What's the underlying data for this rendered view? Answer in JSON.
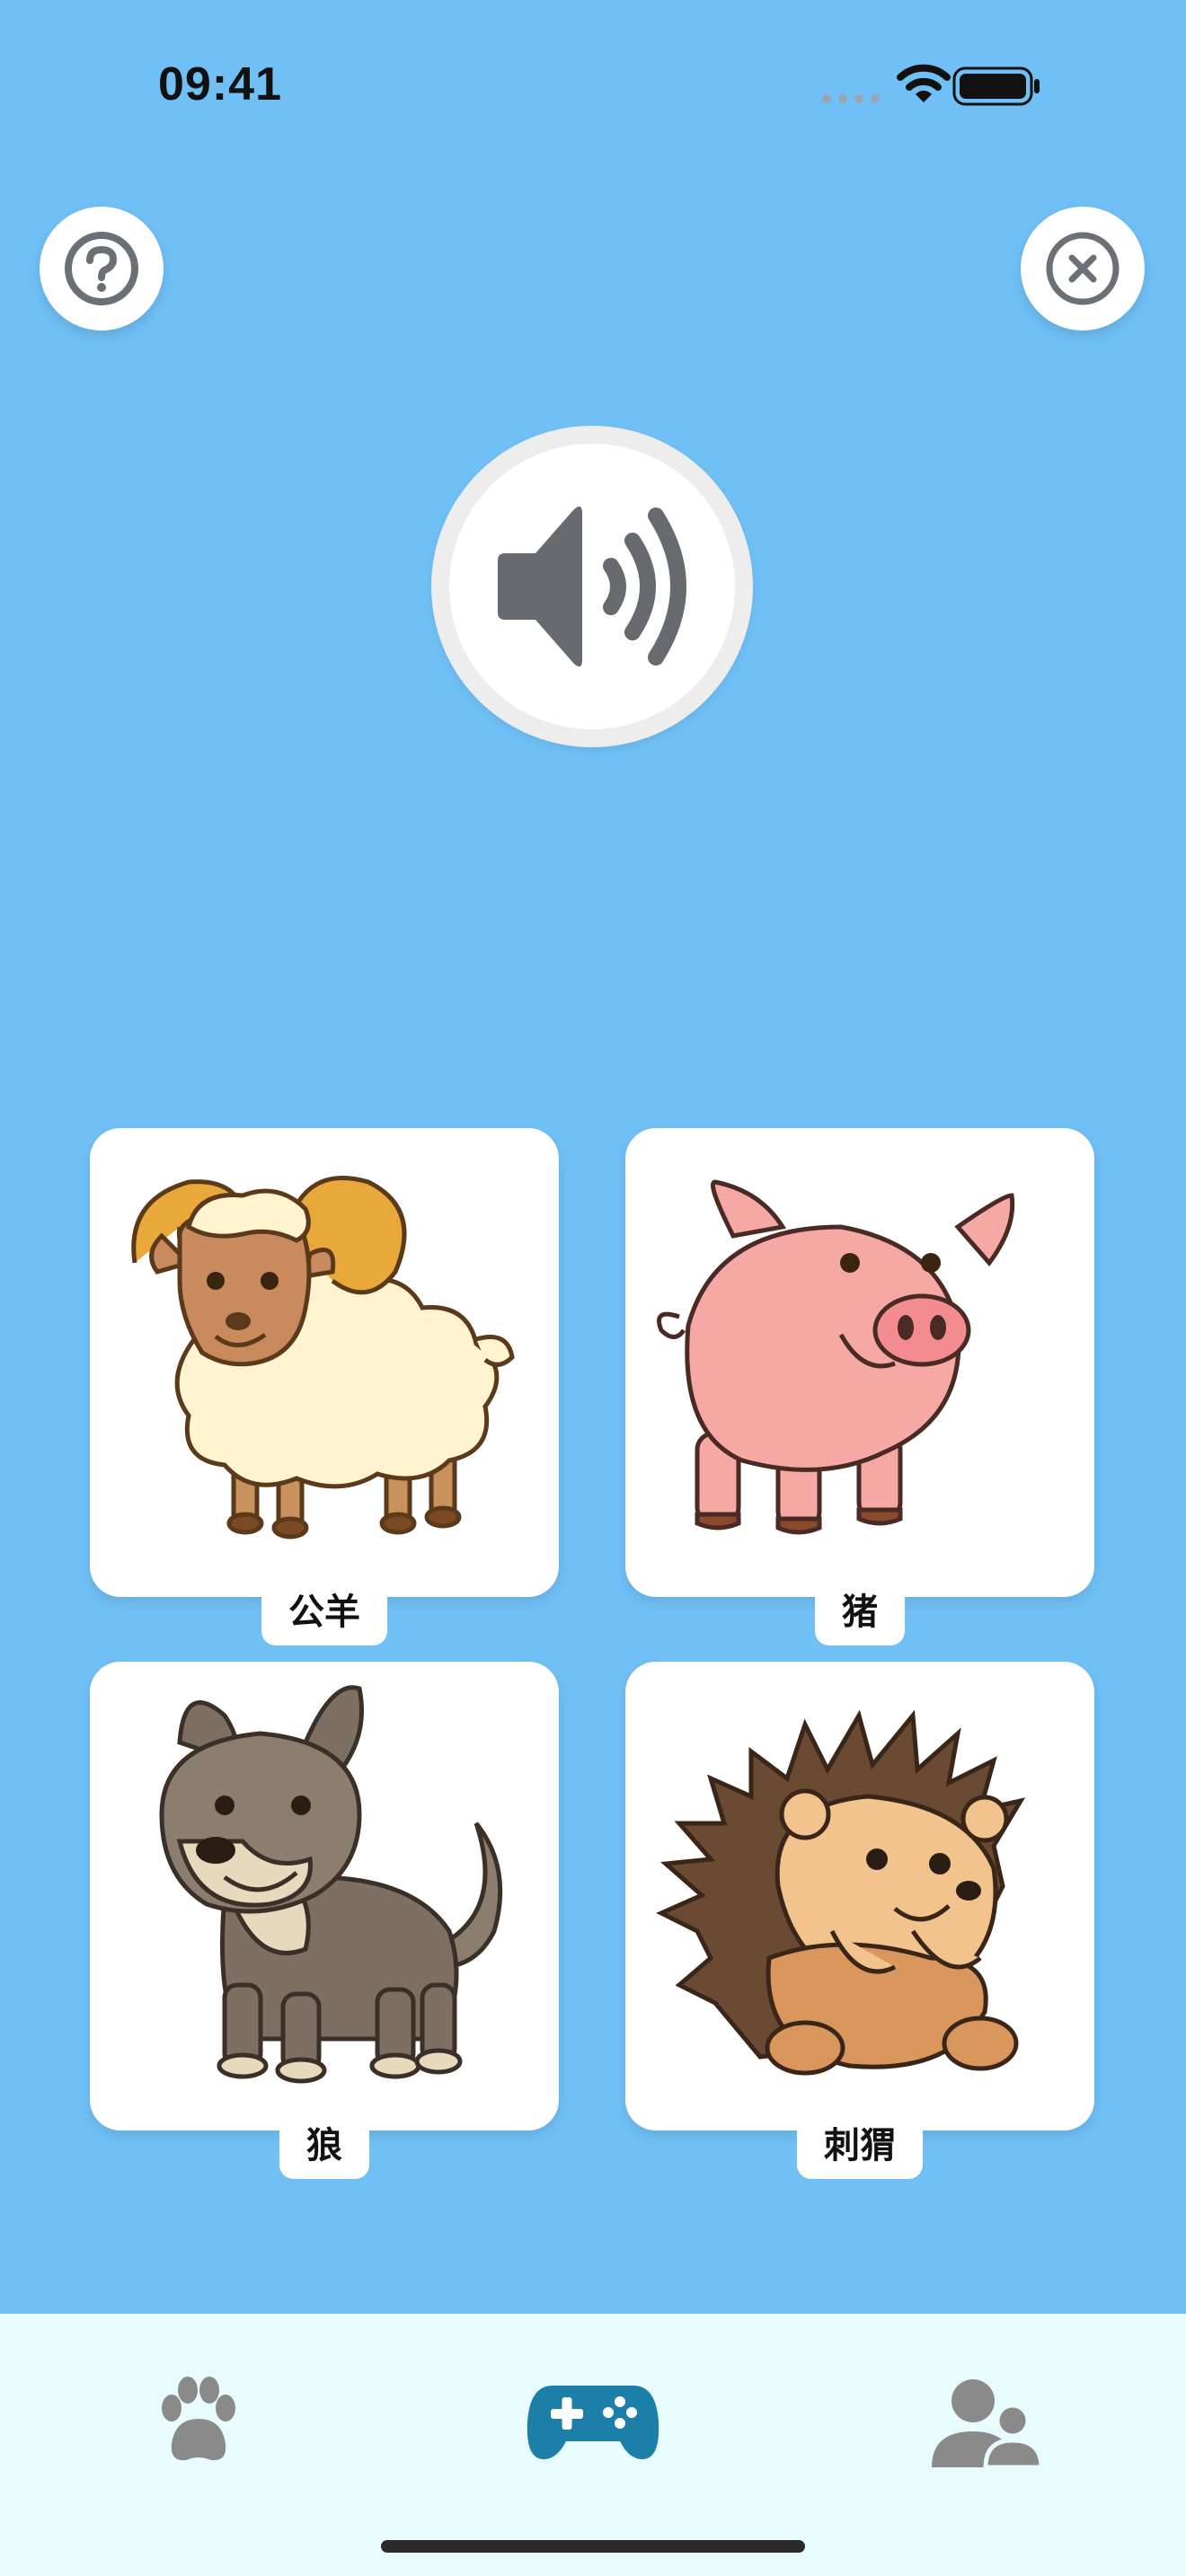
{
  "status_bar": {
    "time": "09:41"
  },
  "header": {
    "help_icon": "question-circle-icon",
    "close_icon": "close-circle-icon"
  },
  "audio": {
    "icon": "speaker-wave-icon"
  },
  "cards": [
    {
      "label": "公羊",
      "animal": "ram"
    },
    {
      "label": "猪",
      "animal": "pig"
    },
    {
      "label": "狼",
      "animal": "wolf"
    },
    {
      "label": "刺猬",
      "animal": "hedgehog"
    }
  ],
  "tabs": [
    {
      "icon": "paw-icon",
      "active": false
    },
    {
      "icon": "gamepad-icon",
      "active": true
    },
    {
      "icon": "people-icon",
      "active": false
    }
  ],
  "colors": {
    "background": "#70C0F6",
    "tab_bar": "#E9FCFD",
    "active_tab": "#1B7FA8",
    "inactive_tab": "#8A8A8A"
  }
}
